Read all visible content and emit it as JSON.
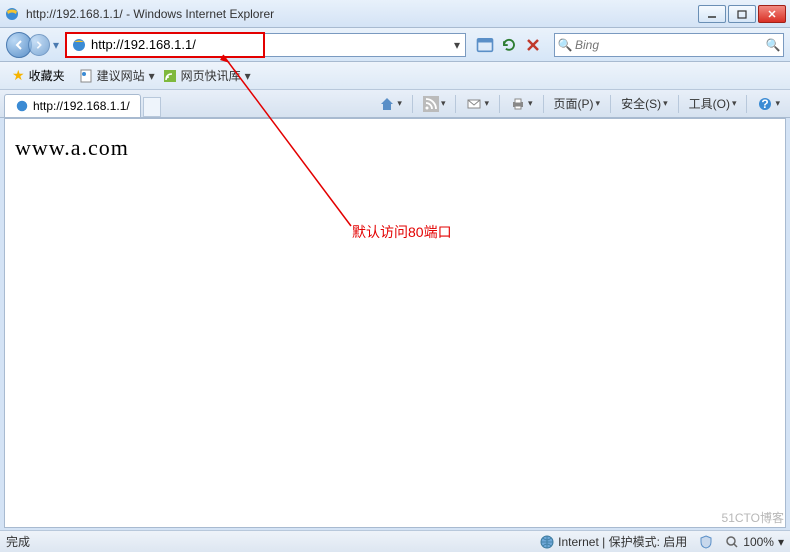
{
  "window": {
    "title": "http://192.168.1.1/ - Windows Internet Explorer"
  },
  "address": {
    "url": "http://192.168.1.1/"
  },
  "search": {
    "placeholder": "Bing"
  },
  "favorites": {
    "button": "收藏夹",
    "suggested": "建议网站",
    "webslice": "网页快讯库"
  },
  "tab": {
    "title": "http://192.168.1.1/"
  },
  "commandbar": {
    "page": "页面(P)",
    "safety": "安全(S)",
    "tools": "工具(O)"
  },
  "page": {
    "body_text": "www.a.com"
  },
  "annotation": {
    "text": "默认访问80端口"
  },
  "status": {
    "done": "完成",
    "zone": "Internet | 保护模式: 启用",
    "zoom": "100%"
  },
  "watermark": "51CTO博客"
}
